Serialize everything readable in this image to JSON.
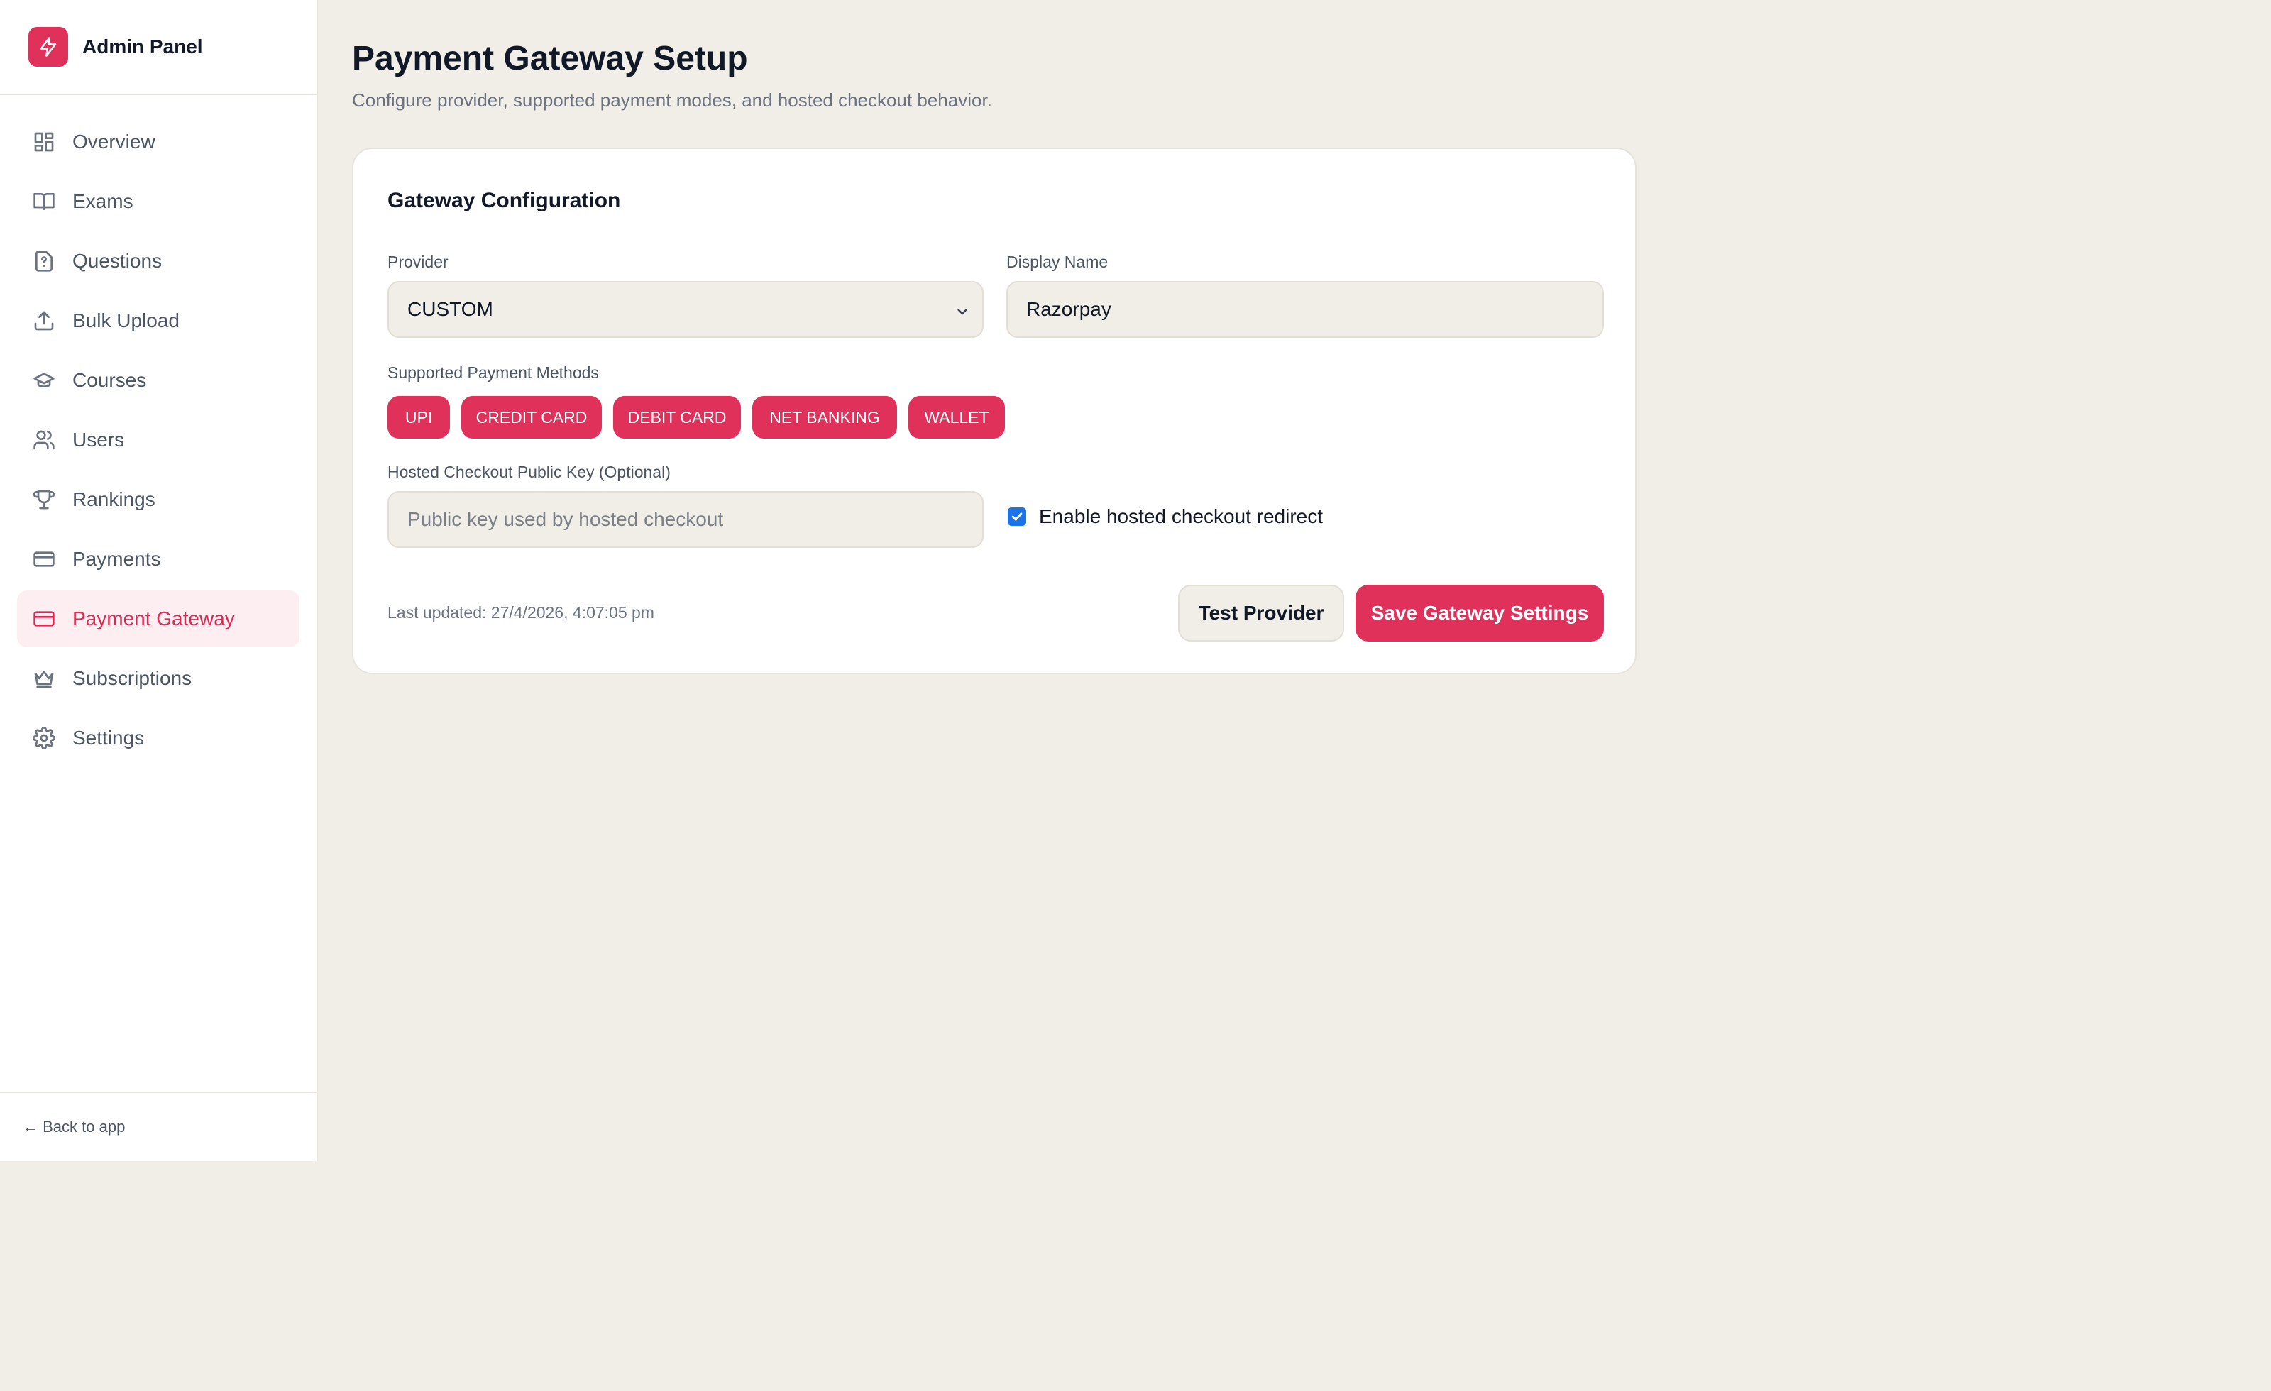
{
  "sidebar": {
    "brand": {
      "title": "Admin Panel",
      "icon": "bolt-icon"
    },
    "items": [
      {
        "label": "Overview",
        "icon": "grid-icon",
        "active": false
      },
      {
        "label": "Exams",
        "icon": "book-icon",
        "active": false
      },
      {
        "label": "Questions",
        "icon": "file-question-icon",
        "active": false
      },
      {
        "label": "Bulk Upload",
        "icon": "upload-icon",
        "active": false
      },
      {
        "label": "Courses",
        "icon": "graduation-cap-icon",
        "active": false
      },
      {
        "label": "Users",
        "icon": "users-icon",
        "active": false
      },
      {
        "label": "Rankings",
        "icon": "trophy-icon",
        "active": false
      },
      {
        "label": "Payments",
        "icon": "credit-card-icon",
        "active": false
      },
      {
        "label": "Payment Gateway",
        "icon": "credit-card-icon",
        "active": true
      },
      {
        "label": "Subscriptions",
        "icon": "crown-icon",
        "active": false
      },
      {
        "label": "Settings",
        "icon": "gear-icon",
        "active": false
      }
    ],
    "footer": {
      "back_label": "← Back to app"
    }
  },
  "header": {
    "title": "Payment Gateway Setup",
    "subtitle": "Configure provider, supported payment modes, and hosted checkout behavior."
  },
  "card": {
    "title": "Gateway Configuration",
    "provider": {
      "label": "Provider",
      "value": "CUSTOM"
    },
    "display_name": {
      "label": "Display Name",
      "value": "Razorpay"
    },
    "methods": {
      "label": "Supported Payment Methods",
      "chips": [
        "UPI",
        "CREDIT CARD",
        "DEBIT CARD",
        "NET BANKING",
        "WALLET"
      ]
    },
    "public_key": {
      "label": "Hosted Checkout Public Key (Optional)",
      "value": "",
      "placeholder": "Public key used by hosted checkout"
    },
    "redirect": {
      "label": "Enable hosted checkout redirect",
      "checked": true
    },
    "last_updated": "Last updated: 27/4/2026, 4:07:05 pm",
    "buttons": {
      "test": "Test Provider",
      "save": "Save Gateway Settings"
    }
  },
  "colors": {
    "accent": "#e0315a",
    "active_bg": "#fdeef1",
    "page_bg": "#f1eee8",
    "checkbox": "#1a73e8"
  }
}
